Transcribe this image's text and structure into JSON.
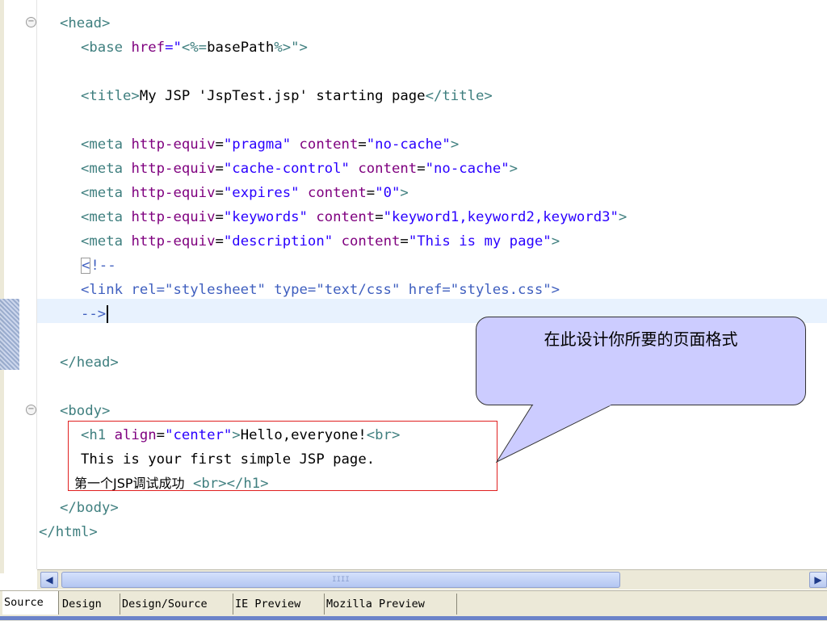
{
  "editor": {
    "lines": {
      "head_open": "<head>",
      "base_tag_open": "<base ",
      "base_attr": "href",
      "base_eq": "=\"",
      "base_jsp_open": "<%=",
      "base_jsp_body": "basePath",
      "base_jsp_close": "%>",
      "base_end": "\">",
      "title_open": "<title>",
      "title_text": "My JSP 'JspTest.jsp' starting page",
      "title_close": "</title>",
      "meta_tag": "<meta ",
      "meta_attr1": "http-equiv",
      "meta_attr2": "content",
      "meta1_v1": "\"pragma\"",
      "meta1_v2": "\"no-cache\"",
      "meta2_v1": "\"cache-control\"",
      "meta2_v2": "\"no-cache\"",
      "meta3_v1": "\"expires\"",
      "meta3_v2": "\"0\"",
      "meta4_v1": "\"keywords\"",
      "meta4_v2": "\"keyword1,keyword2,keyword3\"",
      "meta5_v1": "\"description\"",
      "meta5_v2": "\"This is my page\"",
      "comment_open_lt": "<",
      "comment_open_rest": "!--",
      "link_line": "<link rel=\"stylesheet\" type=\"text/css\" href=\"styles.css\">",
      "comment_close": "-->",
      "head_close": "</head>",
      "body_open": "<body>",
      "h1_open": "<h1 ",
      "h1_attr": "align",
      "h1_val": "\"center\"",
      "h1_gt": ">",
      "h1_text": "Hello,everyone!",
      "br_tag": "<br>",
      "line_simple": "This is your first simple JSP page.",
      "line_cn": "第一个JSP调试成功",
      "h1_close": "</h1>",
      "body_close": "</body>",
      "html_close": "</html>"
    }
  },
  "callout": {
    "text": "在此设计你所要的页面格式",
    "fill_color": "#ccccff"
  },
  "scrollbar": {
    "left_icon": "chevron-left-icon",
    "right_icon": "chevron-right-icon",
    "thumb_grip": "IIII"
  },
  "tabs": {
    "source": "Source",
    "design": "Design",
    "design_source": "Design/Source",
    "ie_preview": "IE Preview",
    "mozilla_preview": "Mozilla Preview"
  }
}
